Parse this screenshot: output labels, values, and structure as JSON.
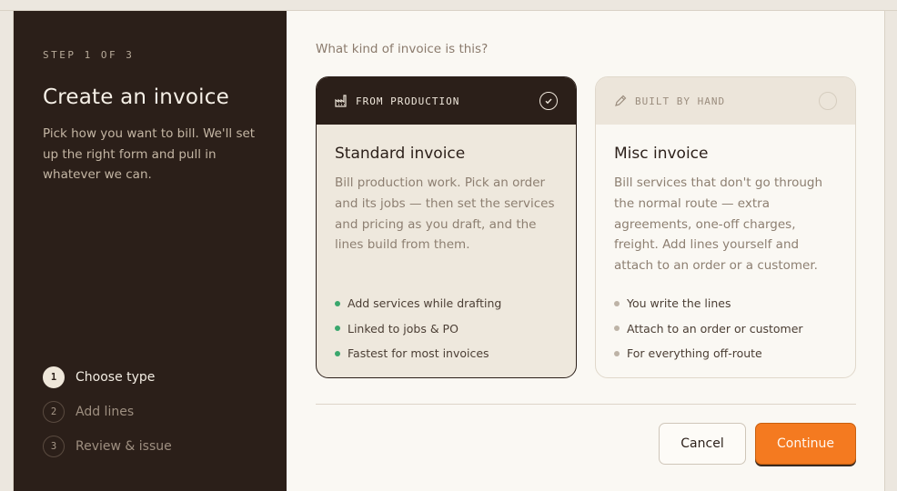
{
  "sidebar": {
    "step_label": "STEP 1 OF 3",
    "title": "Create an invoice",
    "subtitle": "Pick how you want to bill. We'll set up the right form and pull in whatever we can.",
    "steps": [
      {
        "num": "1",
        "label": "Choose type",
        "active": true
      },
      {
        "num": "2",
        "label": "Add lines",
        "active": false
      },
      {
        "num": "3",
        "label": "Review & issue",
        "active": false
      }
    ]
  },
  "main": {
    "question": "What kind of invoice is this?",
    "cards": [
      {
        "tag": "FROM PRODUCTION",
        "icon": "factory-icon",
        "selected": true,
        "title": "Standard invoice",
        "description": "Bill production work. Pick an order and its jobs — then set the services and pricing as you draft, and the lines build from them.",
        "bullets": [
          "Add services while drafting",
          "Linked to jobs & PO",
          "Fastest for most invoices"
        ]
      },
      {
        "tag": "BUILT BY HAND",
        "icon": "pencil-icon",
        "selected": false,
        "title": "Misc invoice",
        "description": "Bill services that don't go through the normal route — extra agreements, one-off charges, freight. Add lines yourself and attach to an order or a customer.",
        "bullets": [
          "You write the lines",
          "Attach to an order or customer",
          "For everything off-route"
        ]
      }
    ]
  },
  "footer": {
    "cancel_label": "Cancel",
    "continue_label": "Continue"
  },
  "colors": {
    "sidebar_bg": "#2b1f19",
    "accent": "#f47a20",
    "bullet_selected": "#3aa76d"
  }
}
